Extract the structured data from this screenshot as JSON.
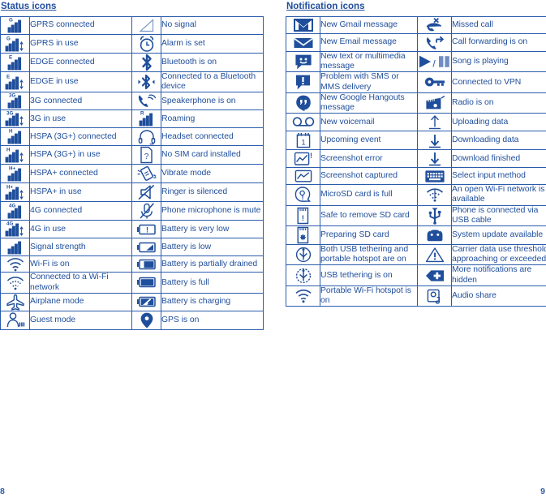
{
  "sections": {
    "status": {
      "title": "Status icons",
      "rows": [
        [
          {
            "icon": "signal-gprs-connected-icon",
            "label": "GPRS connected"
          },
          {
            "icon": "no-signal-icon",
            "label": "No signal"
          }
        ],
        [
          {
            "icon": "signal-gprs-in-use-icon",
            "label": "GPRS in use"
          },
          {
            "icon": "alarm-clock-icon",
            "label": "Alarm is set"
          }
        ],
        [
          {
            "icon": "signal-edge-connected-icon",
            "label": "EDGE connected"
          },
          {
            "icon": "bluetooth-icon",
            "label": "Bluetooth is on"
          }
        ],
        [
          {
            "icon": "signal-edge-in-use-icon",
            "label": "EDGE in use"
          },
          {
            "icon": "bluetooth-connected-icon",
            "label": "Connected to a Bluetooth device"
          }
        ],
        [
          {
            "icon": "signal-3g-connected-icon",
            "label": "3G connected"
          },
          {
            "icon": "speakerphone-icon",
            "label": "Speakerphone is on"
          }
        ],
        [
          {
            "icon": "signal-3g-in-use-icon",
            "label": "3G in use"
          },
          {
            "icon": "roaming-icon",
            "label": "Roaming"
          }
        ],
        [
          {
            "icon": "signal-hspa-connected-icon",
            "label": "HSPA (3G+) connected"
          },
          {
            "icon": "headset-icon",
            "label": "Headset connected"
          }
        ],
        [
          {
            "icon": "signal-hspa-in-use-icon",
            "label": "HSPA (3G+) in use"
          },
          {
            "icon": "no-sim-card-icon",
            "label": "No SIM card installed"
          }
        ],
        [
          {
            "icon": "signal-hspaplus-connected-icon",
            "label": "HSPA+ connected"
          },
          {
            "icon": "vibrate-mode-icon",
            "label": "Vibrate mode"
          }
        ],
        [
          {
            "icon": "signal-hspaplus-in-use-icon",
            "label": "HSPA+ in use"
          },
          {
            "icon": "ringer-silenced-icon",
            "label": "Ringer is silenced"
          }
        ],
        [
          {
            "icon": "signal-4g-connected-icon",
            "label": "4G connected"
          },
          {
            "icon": "microphone-mute-icon",
            "label": "Phone microphone is mute"
          }
        ],
        [
          {
            "icon": "signal-4g-in-use-icon",
            "label": "4G in use"
          },
          {
            "icon": "battery-very-low-icon",
            "label": "Battery is very low"
          }
        ],
        [
          {
            "icon": "signal-strength-icon",
            "label": "Signal strength"
          },
          {
            "icon": "battery-low-icon",
            "label": "Battery is low"
          }
        ],
        [
          {
            "icon": "wifi-on-icon",
            "label": "Wi-Fi is on"
          },
          {
            "icon": "battery-partially-drained-icon",
            "label": "Battery is partially drained"
          }
        ],
        [
          {
            "icon": "wifi-connected-icon",
            "label": "Connected to a Wi-Fi network"
          },
          {
            "icon": "battery-full-icon",
            "label": "Battery is full"
          }
        ],
        [
          {
            "icon": "airplane-mode-icon",
            "label": "Airplane mode"
          },
          {
            "icon": "battery-charging-icon",
            "label": "Battery is charging"
          }
        ],
        [
          {
            "icon": "guest-mode-icon",
            "label": "Guest mode"
          },
          {
            "icon": "gps-on-icon",
            "label": "GPS is on"
          }
        ]
      ]
    },
    "notification": {
      "title": "Notification icons",
      "rows": [
        [
          {
            "icon": "gmail-icon",
            "label": "New Gmail message"
          },
          {
            "icon": "missed-call-icon",
            "label": "Missed call"
          }
        ],
        [
          {
            "icon": "email-icon",
            "label": "New Email message"
          },
          {
            "icon": "call-forwarding-icon",
            "label": "Call forwarding is on"
          }
        ],
        [
          {
            "icon": "sms-mms-icon",
            "label": "New text or multimedia message"
          },
          {
            "icon": "song-playing-icon",
            "label": "Song is playing"
          }
        ],
        [
          {
            "icon": "sms-problem-icon",
            "label": "Problem with SMS or MMS delivery"
          },
          {
            "icon": "vpn-icon",
            "label": "Connected to VPN"
          }
        ],
        [
          {
            "icon": "hangouts-icon",
            "label": "New Google Hangouts message"
          },
          {
            "icon": "radio-icon",
            "label": "Radio is on"
          }
        ],
        [
          {
            "icon": "voicemail-icon",
            "label": "New voicemail"
          },
          {
            "icon": "upload-icon",
            "label": "Uploading data"
          }
        ],
        [
          {
            "icon": "calendar-event-icon",
            "label": "Upcoming event"
          },
          {
            "icon": "download-icon",
            "label": "Downloading data"
          }
        ],
        [
          {
            "icon": "screenshot-error-icon",
            "label": "Screenshot error"
          },
          {
            "icon": "download-finished-icon",
            "label": "Download finished"
          }
        ],
        [
          {
            "icon": "screenshot-captured-icon",
            "label": " Screenshot captured"
          },
          {
            "icon": "keyboard-icon",
            "label": "Select input method"
          }
        ],
        [
          {
            "icon": "microsd-full-icon",
            "label": "MicroSD card is full"
          },
          {
            "icon": "open-wifi-icon",
            "label": "An open Wi-Fi network is available"
          }
        ],
        [
          {
            "icon": "sd-card-safe-remove-icon",
            "label": "Safe to remove SD card"
          },
          {
            "icon": "usb-cable-icon",
            "label": "Phone is connected via USB cable"
          }
        ],
        [
          {
            "icon": "sd-card-preparing-icon",
            "label": "Preparing SD card"
          },
          {
            "icon": "system-update-icon",
            "label": "System update available"
          }
        ],
        [
          {
            "icon": "usb-tethering-hotspot-icon",
            "label": "Both USB tethering and portable hotspot are on"
          },
          {
            "icon": "warning-icon",
            "label": "Carrier data use threshold approaching or exceeded"
          }
        ],
        [
          {
            "icon": "usb-tethering-icon",
            "label": "USB tethering is on"
          },
          {
            "icon": "more-notifications-icon",
            "label": "More notifications are hidden"
          }
        ],
        [
          {
            "icon": "portable-hotspot-icon",
            "label": "Portable Wi-Fi hotspot is on"
          },
          {
            "icon": "audio-share-icon",
            "label": "Audio share"
          }
        ]
      ]
    }
  },
  "footer": {
    "left_page": "8",
    "right_page": "9"
  },
  "colors": {
    "accent": "#1f4e9c",
    "border": "#2b5cab",
    "background": "#ffffff"
  }
}
